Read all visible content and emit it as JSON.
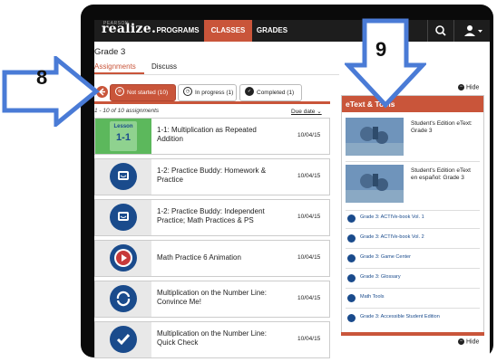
{
  "nav": {
    "logo_top": "PEARSON",
    "logo": "realize.",
    "programs": "PROGRAMS",
    "classes": "CLASSES",
    "grades": "GRADES"
  },
  "header": {
    "title": "Grade 3",
    "tabs": [
      "Assignments",
      "Discuss"
    ]
  },
  "filters": {
    "not_started": "Not started (10)",
    "in_progress": "In progress (1)",
    "completed": "Completed (1)"
  },
  "list_meta": {
    "count": "1 - 10 of 10 assignments",
    "sort": "Due date"
  },
  "assignments": [
    {
      "title": "1-1: Multiplication as Repeated Addition",
      "date": "10/04/15",
      "thumb": "lesson",
      "badge_top": "Lesson",
      "badge_num": "1-1"
    },
    {
      "title": "1-2: Practice Buddy: Homework & Practice",
      "date": "10/04/15",
      "thumb": "practice-buddy-icon"
    },
    {
      "title": "1-2: Practice Buddy: Independent Practice; Math Practices & PS",
      "date": "10/04/15",
      "thumb": "practice-buddy-icon"
    },
    {
      "title": "Math Practice 6 Animation",
      "date": "10/04/15",
      "thumb": "play-icon"
    },
    {
      "title": "Multiplication on the Number Line: Convince Me!",
      "date": "10/04/15",
      "thumb": "refresh-icon"
    },
    {
      "title": "Multiplication on the Number Line: Quick Check",
      "date": "10/04/15",
      "thumb": "check-icon"
    }
  ],
  "panel": {
    "hide": "Hide",
    "title": "eText & Tools",
    "etexts": [
      "Student's Edition eText: Grade 3",
      "Student's Edition eText en español: Grade 3"
    ],
    "tools": [
      "Grade 3: ACTIVe-book Vol. 1",
      "Grade 3: ACTIVe-book Vol. 2",
      "Grade 3: Game Center",
      "Grade 3: Glossary",
      "Math Tools",
      "Grade 3: Accessible Student Edition"
    ]
  },
  "callouts": {
    "left": "8",
    "right": "9"
  },
  "colors": {
    "accent": "#c9553a",
    "nav_bg": "#1d1d1d",
    "arrow": "#4a7bd6",
    "lesson_green": "#5cb85c",
    "badge_blue": "#1a4b8c"
  }
}
